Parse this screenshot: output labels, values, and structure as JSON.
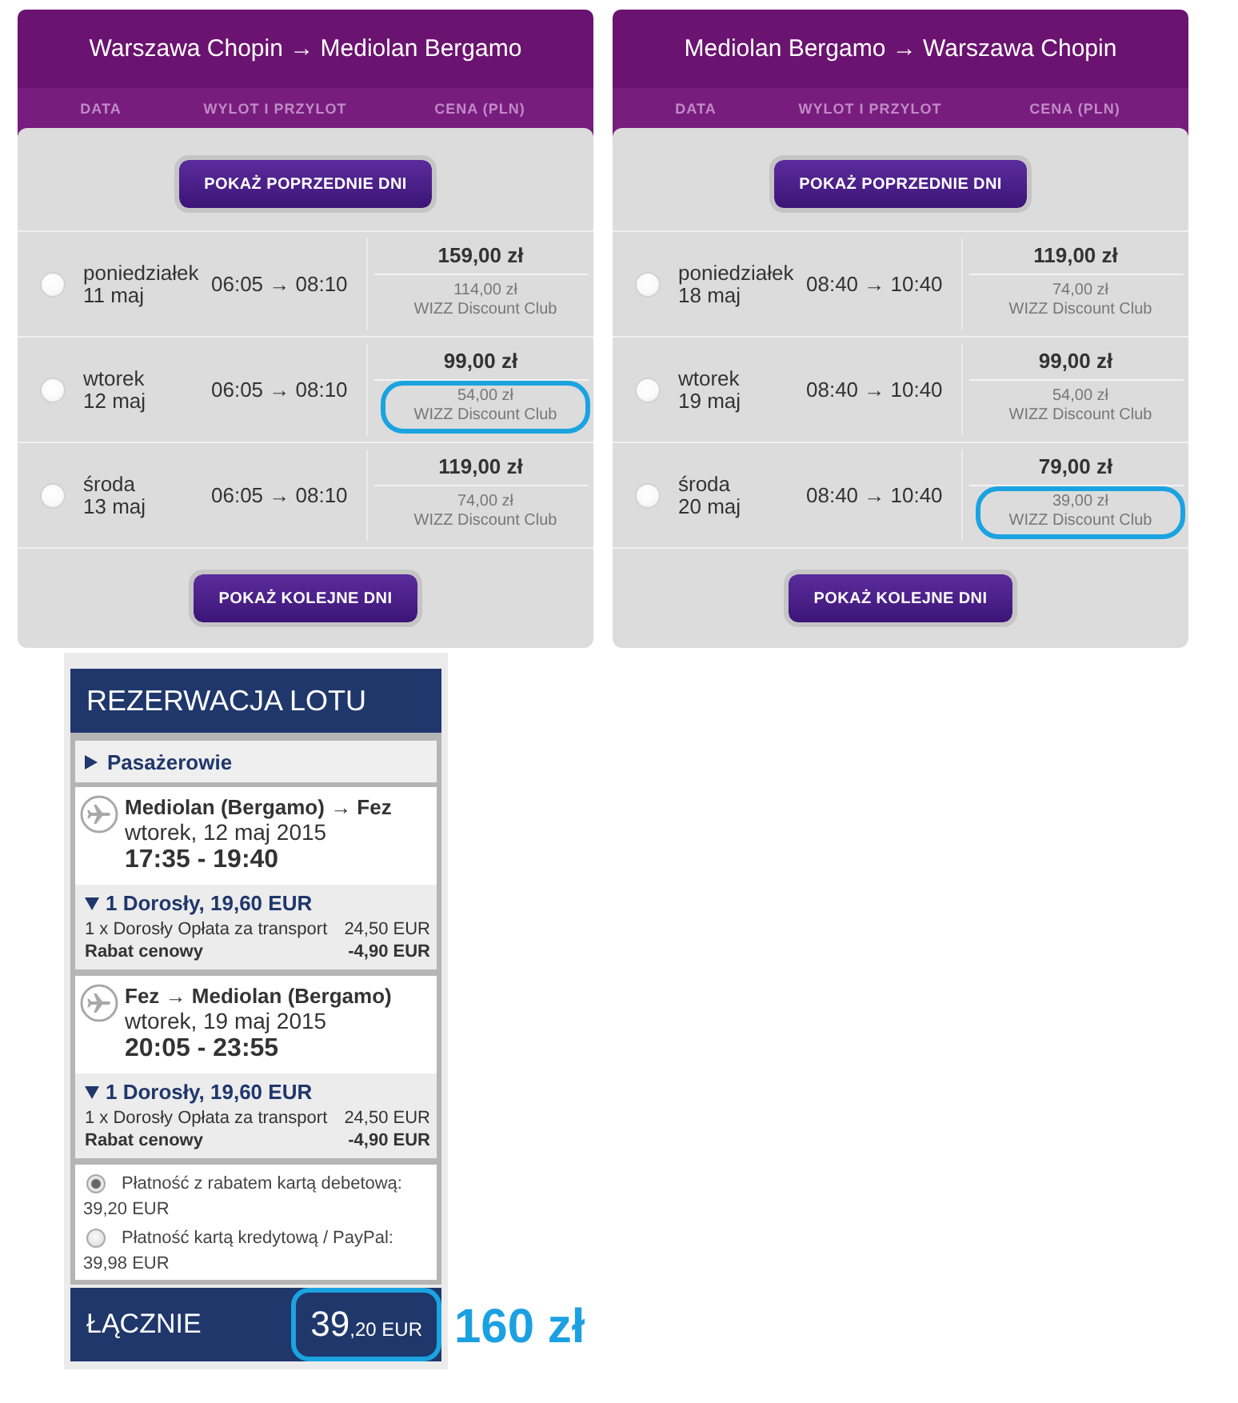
{
  "flight_panels": [
    {
      "title": "Warszawa Chopin → Mediolan Bergamo",
      "columns": [
        "DATA",
        "WYLOT I PRZYLOT",
        "CENA (PLN)"
      ],
      "previous_button": "POKAŻ POPRZEDNIE DNI",
      "days": [
        {
          "weekday": "poniedziałek",
          "date": "11 maj",
          "times": "06:05 → 08:10",
          "price": "159,00 zł",
          "club_price": "114,00 zł",
          "club_label": "WIZZ Discount Club",
          "selected": false,
          "highlighted": false
        },
        {
          "weekday": "wtorek",
          "date": "12 maj",
          "times": "06:05 → 08:10",
          "price": "99,00 zł",
          "club_price": "54,00 zł",
          "club_label": "WIZZ Discount Club",
          "selected": false,
          "highlighted": true
        },
        {
          "weekday": "środa",
          "date": "13 maj",
          "times": "06:05 → 08:10",
          "price": "119,00 zł",
          "club_price": "74,00 zł",
          "club_label": "WIZZ Discount Club",
          "selected": false,
          "highlighted": false
        }
      ],
      "next_button": "POKAŻ KOLEJNE DNI"
    },
    {
      "title": "Mediolan Bergamo → Warszawa Chopin",
      "columns": [
        "DATA",
        "WYLOT I PRZYLOT",
        "CENA (PLN)"
      ],
      "previous_button": "POKAŻ POPRZEDNIE DNI",
      "days": [
        {
          "weekday": "poniedziałek",
          "date": "18 maj",
          "times": "08:40 → 10:40",
          "price": "119,00 zł",
          "club_price": "74,00 zł",
          "club_label": "WIZZ Discount Club",
          "selected": false,
          "highlighted": false
        },
        {
          "weekday": "wtorek",
          "date": "19 maj",
          "times": "08:40 → 10:40",
          "price": "99,00 zł",
          "club_price": "54,00 zł",
          "club_label": "WIZZ Discount Club",
          "selected": false,
          "highlighted": false
        },
        {
          "weekday": "środa",
          "date": "20 maj",
          "times": "08:40 → 10:40",
          "price": "79,00 zł",
          "club_price": "39,00 zł",
          "club_label": "WIZZ Discount Club",
          "selected": false,
          "highlighted": true
        }
      ],
      "next_button": "POKAŻ KOLEJNE DNI"
    }
  ],
  "booking": {
    "title": "REZERWACJA LOTU",
    "passengers": {
      "label": "Pasażerowie",
      "expanded": false
    },
    "flights": [
      {
        "route": "Mediolan (Bergamo) → Fez",
        "date": "wtorek, 12 maj 2015",
        "time": "17:35 - 19:40",
        "fare": {
          "summary": "1 Dorosły, 19,60 EUR",
          "expanded": true,
          "lines": [
            {
              "kind": "fee",
              "label": "1 x Dorosły Opłata za transport",
              "amount": "24,50 EUR"
            },
            {
              "kind": "discount",
              "label": "Rabat cenowy",
              "amount": "-4,90 EUR"
            }
          ]
        }
      },
      {
        "route": "Fez → Mediolan (Bergamo)",
        "date": "wtorek, 19 maj 2015",
        "time": "20:05 - 23:55",
        "fare": {
          "summary": "1 Dorosły, 19,60 EUR",
          "expanded": true,
          "lines": [
            {
              "kind": "fee",
              "label": "1 x Dorosły Opłata za transport",
              "amount": "24,50 EUR"
            },
            {
              "kind": "discount",
              "label": "Rabat cenowy",
              "amount": "-4,90 EUR"
            }
          ]
        }
      }
    ],
    "payment_options": [
      {
        "label": "Płatność z rabatem kartą debetową:",
        "amount": "39,20 EUR",
        "selected": true
      },
      {
        "label": "Płatność kartą kredytową / PayPal:",
        "amount": "39,98 EUR",
        "selected": false
      }
    ],
    "total": {
      "label": "ŁĄCZNIE",
      "amount": "39",
      "amount_small": ",20 EUR",
      "highlighted": true
    }
  },
  "annotation": "160 zł"
}
